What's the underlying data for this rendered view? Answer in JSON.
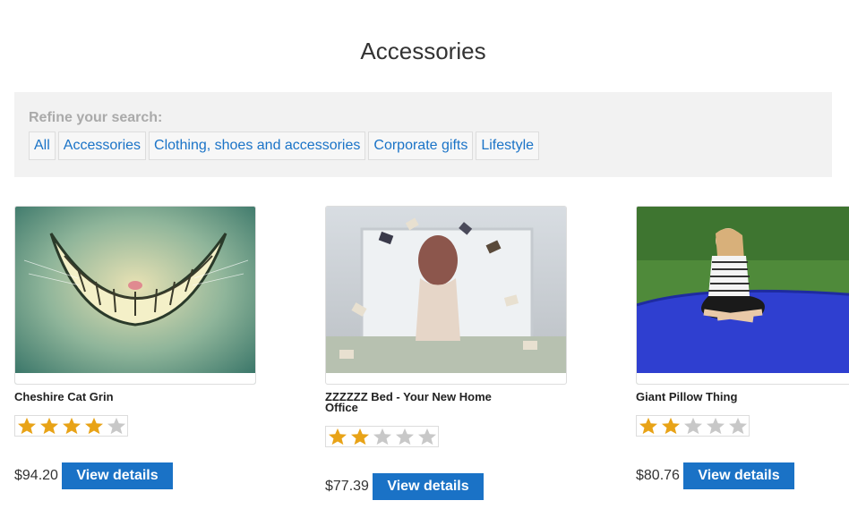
{
  "page": {
    "title": "Accessories"
  },
  "refine": {
    "label": "Refine your search:",
    "filters": [
      "All",
      "Accessories",
      "Clothing, shoes and accessories",
      "Corporate gifts",
      "Lifestyle"
    ]
  },
  "products": [
    {
      "name": "Cheshire Cat Grin",
      "rating": 4,
      "rating_max": 5,
      "price": "$94.20",
      "button": "View details"
    },
    {
      "name": "ZZZZZZ Bed - Your New Home Office",
      "rating": 2,
      "rating_max": 5,
      "price": "$77.39",
      "button": "View details"
    },
    {
      "name": "Giant Pillow Thing",
      "rating": 2,
      "rating_max": 5,
      "price": "$80.76",
      "button": "View details"
    }
  ],
  "colors": {
    "link": "#1a73c7",
    "button": "#1a72c6",
    "star_on": "#e8a317",
    "star_off": "#c8c8c8"
  }
}
